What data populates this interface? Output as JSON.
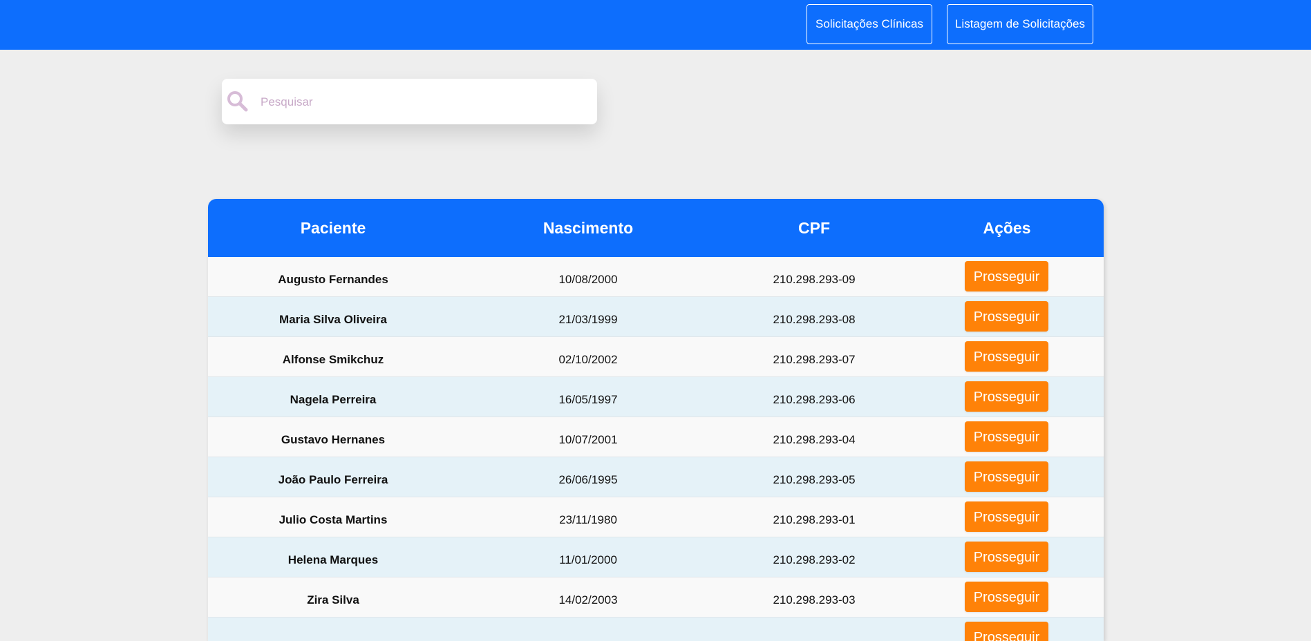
{
  "header": {
    "nav": [
      {
        "label": "Solicitações Clínicas"
      },
      {
        "label": "Listagem de Solicitações"
      }
    ]
  },
  "search": {
    "placeholder": "Pesquisar",
    "value": ""
  },
  "table": {
    "columns": [
      "Paciente",
      "Nascimento",
      "CPF",
      "Ações"
    ],
    "action_label": "Prosseguir",
    "rows": [
      {
        "name": "Augusto Fernandes",
        "birth": "10/08/2000",
        "cpf": "210.298.293-09"
      },
      {
        "name": "Maria Silva Oliveira",
        "birth": "21/03/1999",
        "cpf": "210.298.293-08"
      },
      {
        "name": "Alfonse Smikchuz",
        "birth": "02/10/2002",
        "cpf": "210.298.293-07"
      },
      {
        "name": "Nagela Perreira",
        "birth": "16/05/1997",
        "cpf": "210.298.293-06"
      },
      {
        "name": "Gustavo Hernanes",
        "birth": "10/07/2001",
        "cpf": "210.298.293-04"
      },
      {
        "name": "João Paulo Ferreira",
        "birth": "26/06/1995",
        "cpf": "210.298.293-05"
      },
      {
        "name": "Julio Costa Martins",
        "birth": "23/11/1980",
        "cpf": "210.298.293-01"
      },
      {
        "name": "Helena Marques",
        "birth": "11/01/2000",
        "cpf": "210.298.293-02"
      },
      {
        "name": "Zira Silva",
        "birth": "14/02/2003",
        "cpf": "210.298.293-03"
      },
      {
        "name": "",
        "birth": "",
        "cpf": ""
      }
    ]
  },
  "colors": {
    "primary": "#0d6efd",
    "action": "#ff8208",
    "background": "#eeeeee",
    "row_odd": "#f9f9f9",
    "row_even": "#e5f2f8"
  }
}
